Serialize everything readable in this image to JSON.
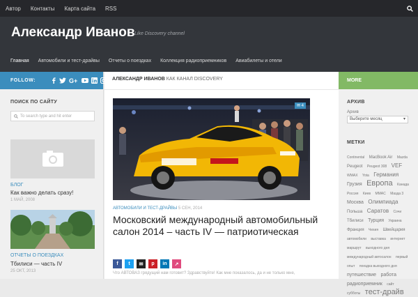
{
  "topbar": {
    "links": [
      "Автор",
      "Контакты",
      "Карта сайта",
      "RSS"
    ]
  },
  "header": {
    "site_title": "Александр Иванов",
    "tagline": "Like Discovery channel",
    "nav": [
      "Главная",
      "Автомобили и тест-драйвы",
      "Отчеты о поездках",
      "Коллекция радиоприемников",
      "Авиабилеты и отели"
    ]
  },
  "left": {
    "follow": "FOLLOW:",
    "social_icons": [
      "facebook-icon",
      "twitter-icon",
      "google-plus-icon",
      "youtube-icon",
      "linkedin-icon",
      "instagram-icon"
    ],
    "search_title": "ПОИСК ПО САЙТУ",
    "search_placeholder": "To search type and hit enter",
    "posts": [
      {
        "category": "БЛОГ",
        "title": "Как важно делать сразу!",
        "date": "1 МАЙ, 2008"
      },
      {
        "category": "ОТЧЕТЫ О ПОЕЗДКАХ",
        "title": "Тбилиси — часть IV",
        "date": "25 ОКТ, 2013"
      }
    ]
  },
  "main": {
    "heading_author": "АЛЕКСАНДР ИВАНОВ",
    "heading_rest": "КАК КАНАЛ DISCOVERY",
    "comment_count": "4",
    "meta_category": "АВТОМОБИЛИ И ТЕСТ-ДРАЙВЫ",
    "meta_date": "5 СЕН, 2014",
    "title": "Московский международный автомобильный салон 2014 – часть IV — патриотическая",
    "excerpt": "Что АВТОВАЗ грядущий нам готовит? Здравствуйте! Как мне показалось, да и не только мне,",
    "share_icons": [
      "facebook-icon",
      "twitter-icon",
      "email-icon",
      "pinterest-icon",
      "linkedin-icon",
      "share-icon"
    ]
  },
  "right": {
    "more": "MORE",
    "archive_title": "АРХИВ",
    "archive_sub": "Архив",
    "archive_select": "Выберите месяц",
    "tags_title": "МЕТКИ",
    "tags": [
      {
        "t": "Continental",
        "s": 5
      },
      {
        "t": "MacBook Air",
        "s": 6
      },
      {
        "t": "Mazda",
        "s": 5
      },
      {
        "t": "Peugeot",
        "s": 6
      },
      {
        "t": "Peugeot 308",
        "s": 5
      },
      {
        "t": "VEF",
        "s": 8
      },
      {
        "t": "WMAX",
        "s": 5
      },
      {
        "t": "Yota",
        "s": 5
      },
      {
        "t": "Германия",
        "s": 8
      },
      {
        "t": "Грузия",
        "s": 7
      },
      {
        "t": "Европа",
        "s": 11
      },
      {
        "t": "Канада",
        "s": 5
      },
      {
        "t": "Россия",
        "s": 5
      },
      {
        "t": "Киев",
        "s": 5
      },
      {
        "t": "MMAC",
        "s": 5
      },
      {
        "t": "Мазда 3",
        "s": 5
      },
      {
        "t": "Москва",
        "s": 7
      },
      {
        "t": "Олимпиада",
        "s": 8
      },
      {
        "t": "Польша",
        "s": 6
      },
      {
        "t": "Саратов",
        "s": 8
      },
      {
        "t": "Сочи",
        "s": 5
      },
      {
        "t": "Тбилиси",
        "s": 6
      },
      {
        "t": "Турция",
        "s": 7
      },
      {
        "t": "Украина",
        "s": 5
      },
      {
        "t": "Франция",
        "s": 6
      },
      {
        "t": "Чехия",
        "s": 5
      },
      {
        "t": "Швейцария",
        "s": 6
      },
      {
        "t": "автомобили",
        "s": 5
      },
      {
        "t": "выставка",
        "s": 5
      },
      {
        "t": "интернет",
        "s": 5
      },
      {
        "t": "маршрут",
        "s": 5
      },
      {
        "t": "выходного дня",
        "s": 5
      },
      {
        "t": "международный автосалон",
        "s": 5
      },
      {
        "t": "первый опыт",
        "s": 5
      },
      {
        "t": "поездка выходного дня",
        "s": 5
      },
      {
        "t": "путешествие",
        "s": 7
      },
      {
        "t": "работа",
        "s": 7
      },
      {
        "t": "радиоприемник",
        "s": 7
      },
      {
        "t": "сайт",
        "s": 5
      },
      {
        "t": "субботы",
        "s": 5
      },
      {
        "t": "тест-драйв",
        "s": 11
      }
    ]
  }
}
